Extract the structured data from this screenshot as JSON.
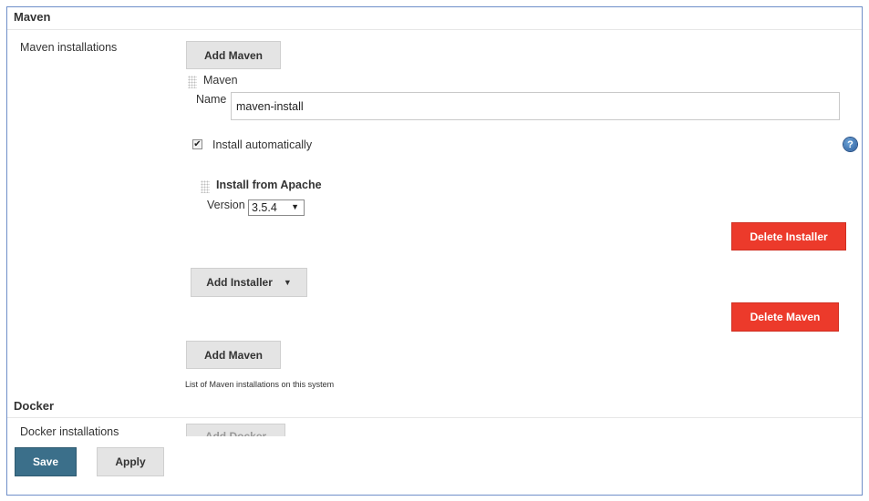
{
  "maven_section": {
    "title": "Maven",
    "installations_label": "Maven installations",
    "add_maven_top": "Add Maven",
    "installation": {
      "header": "Maven",
      "name_label": "Name",
      "name_value": "maven-install",
      "install_auto_label": "Install automatically",
      "install_auto_checked": true,
      "installer": {
        "title": "Install from Apache",
        "version_label": "Version",
        "version_selected": "3.5.4"
      },
      "delete_installer": "Delete Installer",
      "add_installer": "Add Installer",
      "delete_maven": "Delete Maven"
    },
    "add_maven_bottom": "Add Maven",
    "help_text": "List of Maven installations on this system"
  },
  "docker_section": {
    "title": "Docker",
    "installations_label": "Docker installations",
    "add_docker": "Add Docker"
  },
  "footer": {
    "save": "Save",
    "apply": "Apply"
  },
  "help_icon_glyph": "?",
  "colors": {
    "delete": "#ec3a2b",
    "save": "#3b6f8a",
    "frame_border": "#6f8fc9"
  }
}
